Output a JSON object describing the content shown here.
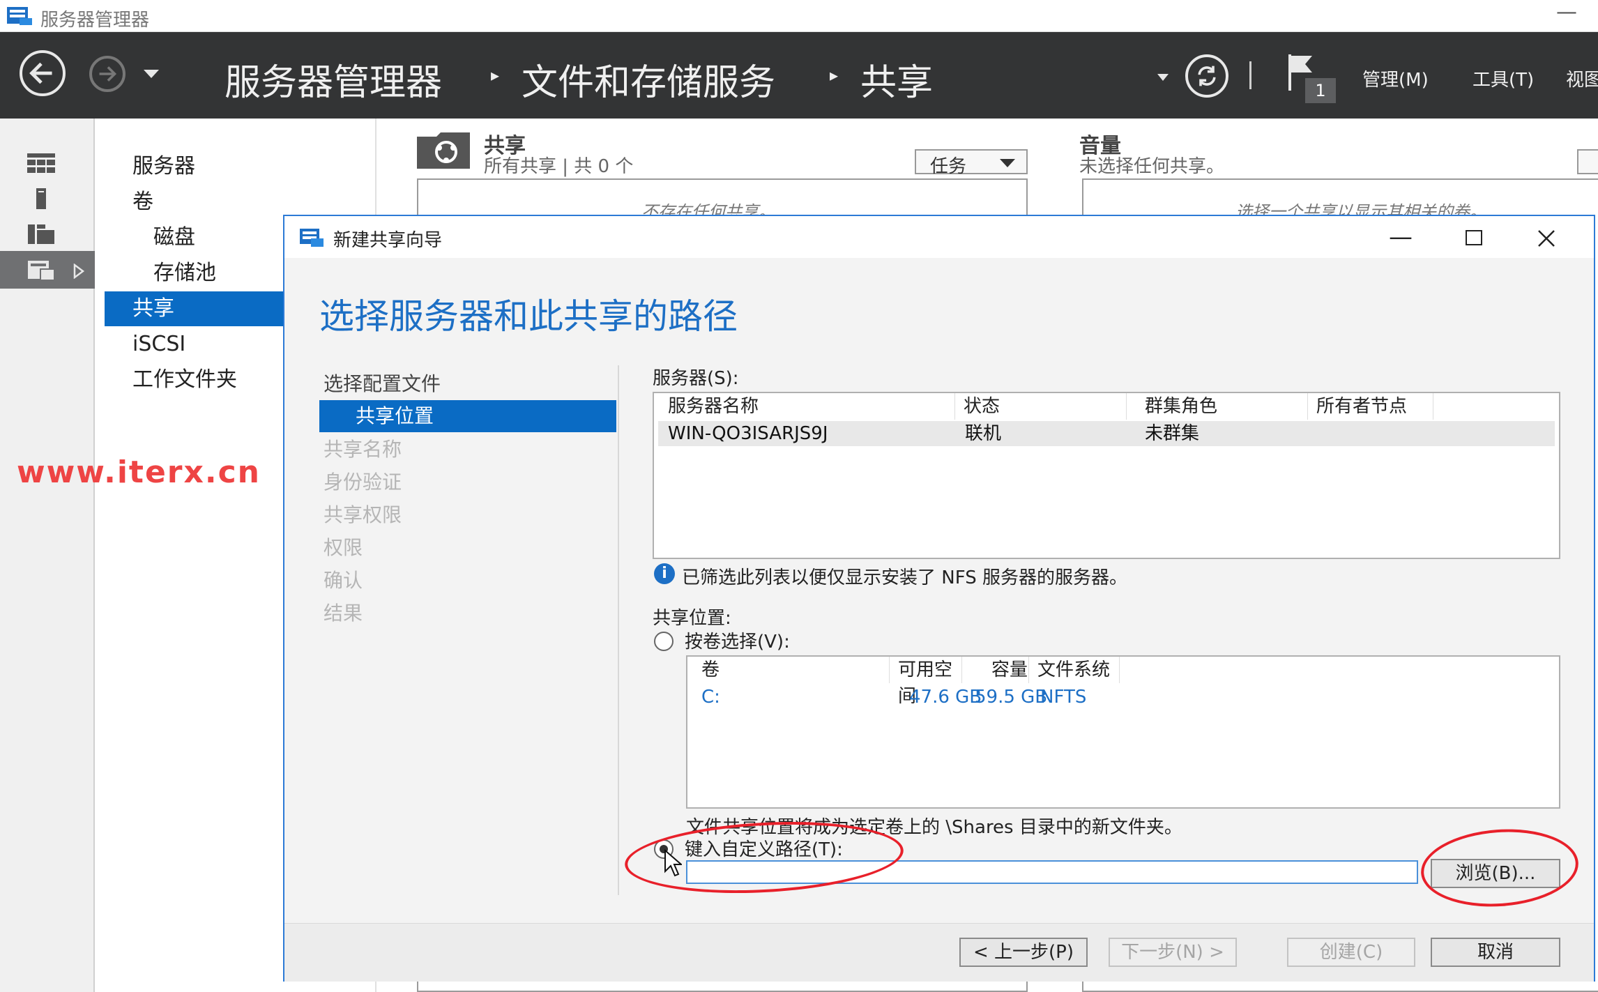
{
  "window": {
    "title": "服务器管理器",
    "minimize": "—"
  },
  "header": {
    "breadcrumb": [
      "服务器管理器",
      "文件和存储服务",
      "共享"
    ],
    "flag_count": "1",
    "menus": [
      "管理(M)",
      "工具(T)",
      "视图"
    ]
  },
  "nav": {
    "items": [
      {
        "label": "服务器"
      },
      {
        "label": "卷"
      },
      {
        "label": "磁盘"
      },
      {
        "label": "存储池"
      },
      {
        "label": "共享"
      },
      {
        "label": "iSCSI"
      },
      {
        "label": "工作文件夹"
      }
    ]
  },
  "background": {
    "shares": {
      "title": "共享",
      "subtitle": "所有共享 | 共 0 个",
      "tasks": "任务",
      "empty": "不存在任何共享。"
    },
    "volume": {
      "title": "音量",
      "subtitle": "未选择任何共享。",
      "empty": "选择一个共享以显示其相关的卷。"
    }
  },
  "watermark": "www.iterx.cn",
  "dialog": {
    "title": "新建共享向导",
    "heading": "选择服务器和此共享的路径",
    "steps": [
      {
        "label": "选择配置文件",
        "state": "done"
      },
      {
        "label": "共享位置",
        "state": "selected"
      },
      {
        "label": "共享名称",
        "state": "disabled"
      },
      {
        "label": "身份验证",
        "state": "disabled"
      },
      {
        "label": "共享权限",
        "state": "disabled"
      },
      {
        "label": "权限",
        "state": "disabled"
      },
      {
        "label": "确认",
        "state": "disabled"
      },
      {
        "label": "结果",
        "state": "disabled"
      }
    ],
    "servers_label": "服务器(S):",
    "server_columns": [
      "服务器名称",
      "状态",
      "群集角色",
      "所有者节点"
    ],
    "server_rows": [
      [
        "WIN-QO3ISARJS9J",
        "联机",
        "未群集",
        ""
      ]
    ],
    "info_text": "已筛选此列表以便仅显示安装了 NFS 服务器的服务器。",
    "share_location_label": "共享位置:",
    "by_volume_label": "按卷选择(V):",
    "volume_columns": [
      "卷",
      "可用空间",
      "容量",
      "文件系统"
    ],
    "volume_rows": [
      [
        "C:",
        "47.6 GB",
        "59.5 GB",
        "NFTS"
      ]
    ],
    "volume_note": "文件共享位置将成为选定卷上的 \\Shares 目录中的新文件夹。",
    "custom_path_label": "键入自定义路径(T):",
    "custom_path_value": "",
    "browse_label": "浏览(B)...",
    "buttons": {
      "back": "< 上一步(P)",
      "next": "下一步(N) >",
      "create": "创建(C)",
      "cancel": "取消"
    }
  }
}
